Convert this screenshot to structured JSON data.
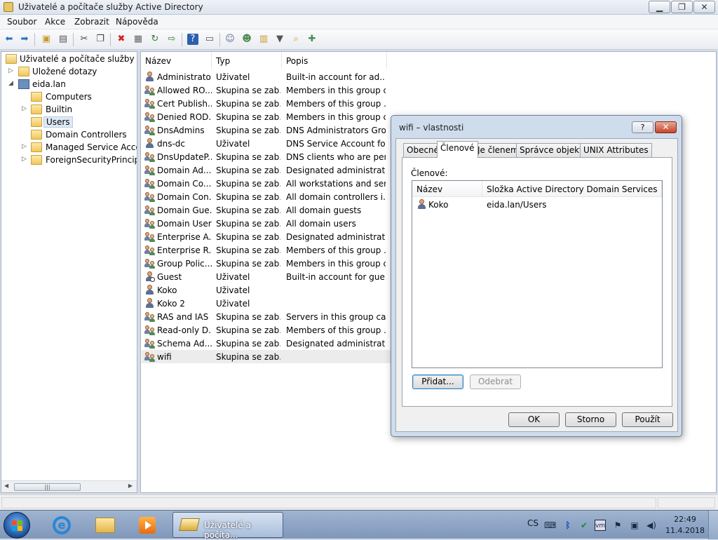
{
  "window": {
    "title": "Uživatelé a počítače služby Active Directory",
    "controls": {
      "minimize": "▁",
      "maximize": "❐",
      "close": "✕"
    }
  },
  "menu": [
    "Soubor",
    "Akce",
    "Zobrazit",
    "Nápověda"
  ],
  "toolbar": {
    "icons": [
      "back-icon",
      "forward-icon",
      "up-folder-icon",
      "show-hide-tree-icon",
      "cut-icon",
      "copy-icon",
      "delete-icon",
      "properties-icon",
      "refresh-icon",
      "export-list-icon",
      "help-icon",
      "show-console-icon",
      "new-user-icon",
      "new-group-icon",
      "new-ou-icon",
      "filter-icon",
      "find-icon",
      "add-to-group-icon"
    ]
  },
  "tree": {
    "root": "Uživatelé a počítače služby Active Directory",
    "items": [
      {
        "label": "Uložené dotazy",
        "level": 1,
        "expander": "▷"
      },
      {
        "label": "eida.lan",
        "level": 1,
        "expander": "◢"
      },
      {
        "label": "Computers",
        "level": 2,
        "expander": ""
      },
      {
        "label": "Builtin",
        "level": 2,
        "expander": "▷"
      },
      {
        "label": "Users",
        "level": 2,
        "expander": ""
      },
      {
        "label": "Domain Controllers",
        "level": 2,
        "expander": ""
      },
      {
        "label": "Managed Service Accounts",
        "level": 2,
        "expander": "▷"
      },
      {
        "label": "ForeignSecurityPrincipals",
        "level": 2,
        "expander": "▷"
      }
    ],
    "scroll_left": "◀",
    "scroll_right": "▶",
    "scroll_grip": "|||"
  },
  "list": {
    "columns": [
      "Název",
      "Typ",
      "Popis"
    ],
    "rows": [
      {
        "icon": "user",
        "name": "Administrator",
        "type": "Uživatel",
        "desc": "Built-in account for ad..."
      },
      {
        "icon": "group",
        "name": "Allowed RO...",
        "type": "Skupina se zab...",
        "desc": "Members in this group c..."
      },
      {
        "icon": "group",
        "name": "Cert Publish...",
        "type": "Skupina se zab...",
        "desc": "Members of this group ..."
      },
      {
        "icon": "group",
        "name": "Denied ROD...",
        "type": "Skupina se zab...",
        "desc": "Members in this group c..."
      },
      {
        "icon": "group",
        "name": "DnsAdmins",
        "type": "Skupina se zab...",
        "desc": "DNS Administrators Gro..."
      },
      {
        "icon": "user",
        "name": "dns-dc",
        "type": "Uživatel",
        "desc": "DNS Service Account for..."
      },
      {
        "icon": "group",
        "name": "DnsUpdateP...",
        "type": "Skupina se zab...",
        "desc": "DNS clients who are per..."
      },
      {
        "icon": "group",
        "name": "Domain Ad...",
        "type": "Skupina se zab...",
        "desc": "Designated administrato..."
      },
      {
        "icon": "group",
        "name": "Domain Co...",
        "type": "Skupina se zab...",
        "desc": "All workstations and ser..."
      },
      {
        "icon": "group",
        "name": "Domain Con...",
        "type": "Skupina se zab...",
        "desc": "All domain controllers i..."
      },
      {
        "icon": "group",
        "name": "Domain Gue...",
        "type": "Skupina se zab...",
        "desc": "All domain guests"
      },
      {
        "icon": "group",
        "name": "Domain Users",
        "type": "Skupina se zab...",
        "desc": "All domain users"
      },
      {
        "icon": "group",
        "name": "Enterprise A...",
        "type": "Skupina se zab...",
        "desc": "Designated administrato..."
      },
      {
        "icon": "group",
        "name": "Enterprise R...",
        "type": "Skupina se zab...",
        "desc": "Members of this group ..."
      },
      {
        "icon": "group",
        "name": "Group Polic...",
        "type": "Skupina se zab...",
        "desc": "Members in this group c..."
      },
      {
        "icon": "user-disabled",
        "name": "Guest",
        "type": "Uživatel",
        "desc": "Built-in account for gue..."
      },
      {
        "icon": "user",
        "name": "Koko",
        "type": "Uživatel",
        "desc": ""
      },
      {
        "icon": "user",
        "name": "Koko 2",
        "type": "Uživatel",
        "desc": ""
      },
      {
        "icon": "group",
        "name": "RAS and IAS ...",
        "type": "Skupina se zab...",
        "desc": "Servers in this group can..."
      },
      {
        "icon": "group",
        "name": "Read-only D...",
        "type": "Skupina se zab...",
        "desc": "Members of this group ..."
      },
      {
        "icon": "group",
        "name": "Schema Ad...",
        "type": "Skupina se zab...",
        "desc": "Designated administrato..."
      },
      {
        "icon": "group",
        "name": "wifi",
        "type": "Skupina se zab...",
        "desc": ""
      }
    ]
  },
  "dialog": {
    "title": "wifi – vlastnosti",
    "help_label": "?",
    "close_label": "✕",
    "tabs": [
      "Obecné",
      "Členové",
      "Je členem",
      "Správce objektu",
      "UNIX Attributes"
    ],
    "active_tab": "Členové",
    "members_label": "Členové:",
    "members_columns": [
      "Název",
      "Složka Active Directory Domain Services"
    ],
    "members": [
      {
        "name": "Koko",
        "folder": "eida.lan/Users"
      }
    ],
    "add_button": "Přidat...",
    "remove_button": "Odebrat",
    "ok_button": "OK",
    "cancel_button": "Storno",
    "apply_button": "Použít"
  },
  "taskbar": {
    "pinned": [
      "internet-explorer-icon",
      "windows-explorer-icon",
      "media-player-icon"
    ],
    "active_window_label": "Uživatelé a počíta...",
    "language": "CS",
    "tray_icons": [
      "keyboard-icon",
      "bluetooth-icon",
      "security-check-icon",
      "vmware-icon",
      "action-center-flag-icon",
      "network-icon",
      "volume-icon"
    ],
    "time": "22:49",
    "date": "11.4.2018"
  }
}
